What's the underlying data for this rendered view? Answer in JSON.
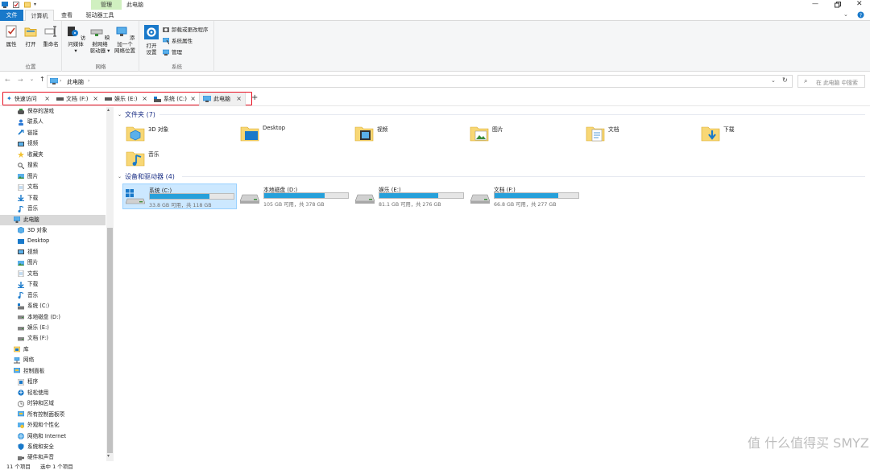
{
  "window": {
    "title": "此电脑",
    "manage_label": "管理"
  },
  "ribbon_tabs": [
    {
      "label": "文件"
    },
    {
      "label": "计算机"
    },
    {
      "label": "查看"
    },
    {
      "label": "驱动器工具"
    }
  ],
  "ribbon": {
    "groups": {
      "location": "位置",
      "network": "网络",
      "system": "系统"
    },
    "buttons": {
      "properties": "属性",
      "open": "打开",
      "rename": "重命名",
      "access_media": "访问媒体",
      "map_drive_1": "映射网络",
      "map_drive_2": "驱动器",
      "add_location_1": "添加一个",
      "add_location_2": "网络位置",
      "open_settings_1": "打开",
      "open_settings_2": "设置",
      "uninstall": "卸载或更改程序",
      "sys_props": "系统属性",
      "manage": "管理"
    }
  },
  "address": {
    "path": "此电脑",
    "search_placeholder": "在 此电脑 中搜索"
  },
  "tabs": [
    {
      "label": "快速访问"
    },
    {
      "label": "文档 (F:)"
    },
    {
      "label": "娱乐 (E:)"
    },
    {
      "label": "系统 (C:)"
    },
    {
      "label": "此电脑"
    }
  ],
  "nav": [
    {
      "label": "保存的游戏",
      "icon": "saved-games-icon"
    },
    {
      "label": "联系人",
      "icon": "contacts-icon"
    },
    {
      "label": "链接",
      "icon": "links-icon"
    },
    {
      "label": "视频",
      "icon": "video-icon"
    },
    {
      "label": "收藏夹",
      "icon": "favorites-icon"
    },
    {
      "label": "搜索",
      "icon": "search-icon"
    },
    {
      "label": "图片",
      "icon": "pictures-icon"
    },
    {
      "label": "文档",
      "icon": "documents-icon"
    },
    {
      "label": "下载",
      "icon": "download-icon"
    },
    {
      "label": "音乐",
      "icon": "music-icon"
    },
    {
      "label": "此电脑",
      "icon": "this-pc-icon"
    },
    {
      "label": "3D 对象",
      "icon": "3d-objects-icon"
    },
    {
      "label": "Desktop",
      "icon": "desktop-icon"
    },
    {
      "label": "视频",
      "icon": "video-icon"
    },
    {
      "label": "图片",
      "icon": "pictures-icon"
    },
    {
      "label": "文档",
      "icon": "documents-icon"
    },
    {
      "label": "下载",
      "icon": "download-icon"
    },
    {
      "label": "音乐",
      "icon": "music-icon"
    },
    {
      "label": "系统 (C:)",
      "icon": "system-drive-icon"
    },
    {
      "label": "本地磁盘 (D:)",
      "icon": "drive-icon"
    },
    {
      "label": "娱乐 (E:)",
      "icon": "drive-icon"
    },
    {
      "label": "文档 (F:)",
      "icon": "drive-icon"
    },
    {
      "label": "库",
      "icon": "library-icon"
    },
    {
      "label": "网络",
      "icon": "network-icon"
    },
    {
      "label": "控制面板",
      "icon": "control-panel-icon"
    },
    {
      "label": "程序",
      "icon": "programs-icon"
    },
    {
      "label": "轻松使用",
      "icon": "ease-of-access-icon"
    },
    {
      "label": "时钟和区域",
      "icon": "clock-icon"
    },
    {
      "label": "所有控制面板项",
      "icon": "control-panel-icon"
    },
    {
      "label": "外观和个性化",
      "icon": "appearance-icon"
    },
    {
      "label": "网络和 Internet",
      "icon": "network-internet-icon"
    },
    {
      "label": "系统和安全",
      "icon": "security-icon"
    },
    {
      "label": "硬件和声音",
      "icon": "hardware-icon"
    }
  ],
  "folders_section": {
    "title": "文件夹 (7)"
  },
  "folders": [
    {
      "label": "3D 对象"
    },
    {
      "label": "Desktop"
    },
    {
      "label": "视频"
    },
    {
      "label": "图片"
    },
    {
      "label": "文档"
    },
    {
      "label": "下载"
    },
    {
      "label": "音乐"
    }
  ],
  "drives_section": {
    "title": "设备和驱动器 (4)"
  },
  "drives": [
    {
      "label": "系统 (C:)",
      "detail": "33.8 GB 可用，共 118 GB",
      "used_fraction": 0.714
    },
    {
      "label": "本地磁盘 (D:)",
      "detail": "105 GB 可用，共 378 GB",
      "used_fraction": 0.722
    },
    {
      "label": "娱乐 (E:)",
      "detail": "81.1 GB 可用，共 276 GB",
      "used_fraction": 0.706
    },
    {
      "label": "文档 (F:)",
      "detail": "66.8 GB 可用，共 277 GB",
      "used_fraction": 0.759
    }
  ],
  "status": {
    "items": "11 个项目",
    "selected": "选中 1 个项目"
  },
  "watermark": "值 什么值得买 SMYZ.NET",
  "colors": {
    "accent": "#1979ca",
    "bar": "#26a0da",
    "highlight": "#cce8ff",
    "tab_border": "#e81123"
  }
}
